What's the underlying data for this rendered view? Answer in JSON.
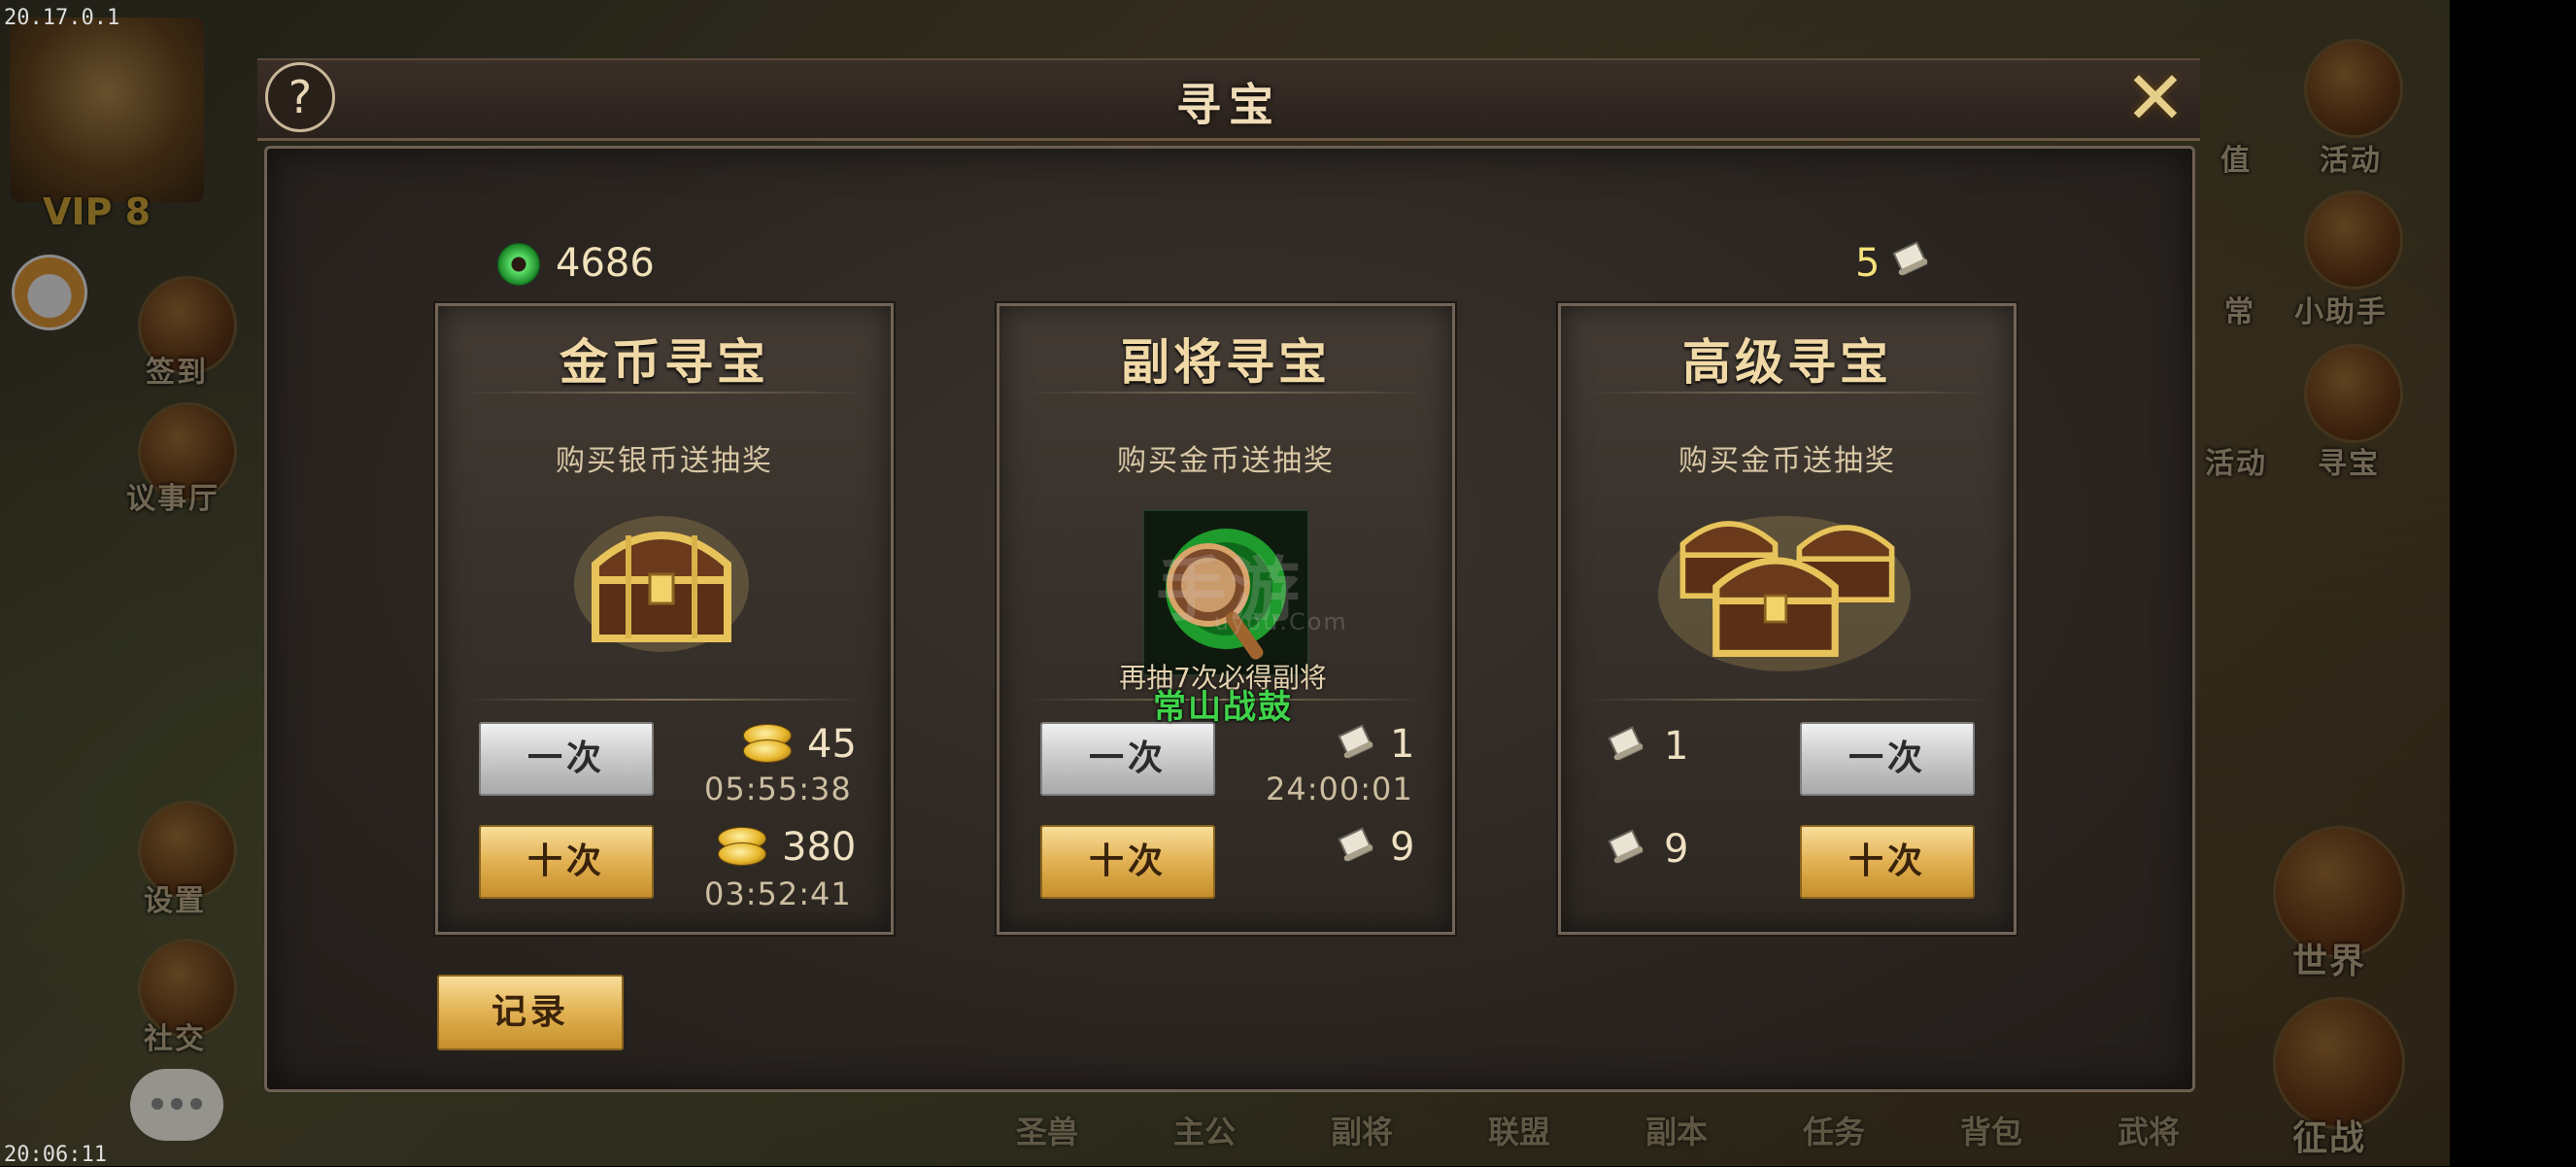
{
  "debug": {
    "version": "20.17.0.1",
    "clock": "20:06:11"
  },
  "player": {
    "vip": "VIP 8"
  },
  "left_menu": [
    {
      "label": "签到"
    },
    {
      "label": "议事厅"
    },
    {
      "label": "设置"
    },
    {
      "label": "社交"
    }
  ],
  "right_menu": [
    {
      "label": "值"
    },
    {
      "label": "活动"
    },
    {
      "label": "常"
    },
    {
      "label": "小助手"
    },
    {
      "label": "活动"
    },
    {
      "label": "寻宝"
    },
    {
      "label": "世界"
    },
    {
      "label": "征战"
    }
  ],
  "bottom_menu": [
    "圣兽",
    "主公",
    "副将",
    "联盟",
    "副本",
    "任务",
    "背包",
    "武将"
  ],
  "dialog": {
    "title": "寻宝",
    "help": "?",
    "close": "✕",
    "jade_amount": "4686",
    "scroll_amount": "5",
    "record_button": "记录"
  },
  "cards": [
    {
      "title": "金币寻宝",
      "subtitle": "购买银币送抽奖",
      "once_label": "一次",
      "ten_label": "十次",
      "once_cost": "45",
      "once_timer": "05:55:38",
      "ten_cost": "380",
      "ten_timer": "03:52:41"
    },
    {
      "title": "副将寻宝",
      "subtitle": "购买金币送抽奖",
      "once_label": "一次",
      "ten_label": "十次",
      "note": "再抽7次必得副将",
      "item_name": "常山战鼓",
      "once_cost": "1",
      "once_timer": "24:00:01",
      "ten_cost": "9"
    },
    {
      "title": "高级寻宝",
      "subtitle": "购买金币送抽奖",
      "once_label": "一次",
      "ten_label": "十次",
      "once_cost": "1",
      "ten_cost": "9"
    }
  ],
  "watermark": {
    "text": "手游",
    "sub": "uyou.Com"
  },
  "icons": [
    "jade-icon",
    "scroll-icon",
    "gold-coin-icon",
    "treasure-chest-icon",
    "war-drum-icon",
    "question-icon",
    "close-icon",
    "chat-icon",
    "cat-avatar-icon"
  ],
  "colors": {
    "gold_button": "#e2b152",
    "silver_button": "#c9c9c9",
    "title_text": "#f0d9a6",
    "item_green": "#3fd34a"
  }
}
